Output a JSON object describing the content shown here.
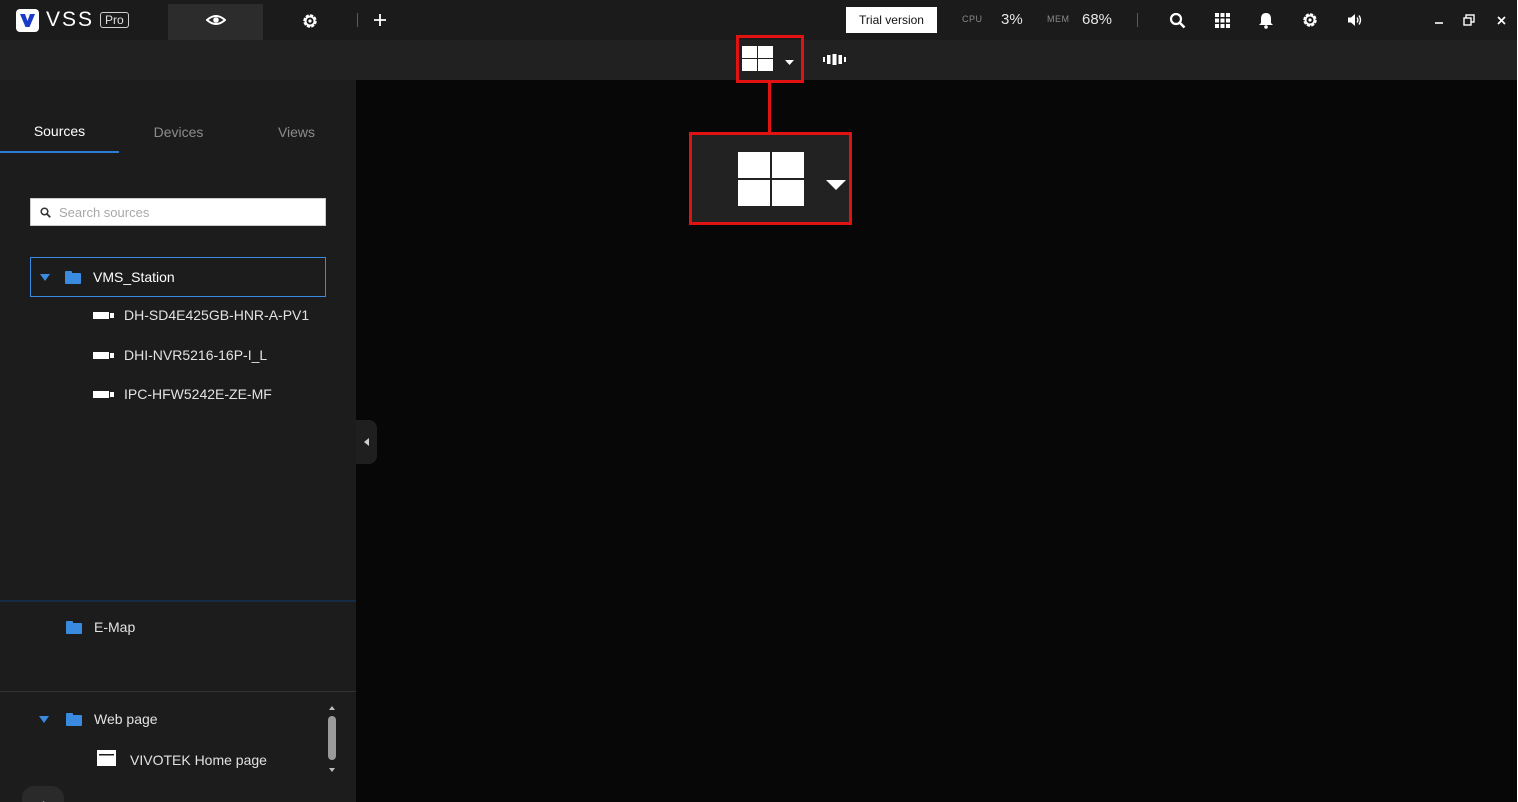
{
  "app": {
    "logo_text": "VSS",
    "logo_badge": "Pro"
  },
  "topbar": {
    "trial_label": "Trial version",
    "cpu_label": "CPU",
    "cpu_value": "3%",
    "mem_label": "MEM",
    "mem_value": "68%",
    "icons": [
      "eye-icon",
      "gear-icon",
      "plus-icon",
      "search-icon",
      "grid-icon",
      "bell-icon",
      "settings-icon",
      "volume-icon",
      "minimize-icon",
      "restore-icon",
      "close-icon"
    ]
  },
  "toolbar": {
    "icons": [
      "layout-2x2-icon",
      "chevron-down-icon",
      "patrol-icon"
    ]
  },
  "sidebar": {
    "tabs": [
      {
        "label": "Sources",
        "active": true
      },
      {
        "label": "Devices",
        "active": false
      },
      {
        "label": "Views",
        "active": false
      }
    ],
    "search": {
      "placeholder": "Search sources",
      "value": ""
    },
    "tree": {
      "root": "VMS_Station",
      "children": [
        "DH-SD4E425GB-HNR-A-PV1",
        "DHI-NVR5216-16P-I_L",
        "IPC-HFW5242E-ZE-MF"
      ]
    },
    "emap": {
      "label": "E-Map"
    },
    "webpage": {
      "label": "Web page",
      "children": [
        "VIVOTEK Home page"
      ]
    }
  },
  "colors": {
    "accent": "#2d7dd2",
    "folder": "#3a8be0",
    "highlight": "#e21212",
    "background": "#070707",
    "panel": "#1c1c1c"
  }
}
